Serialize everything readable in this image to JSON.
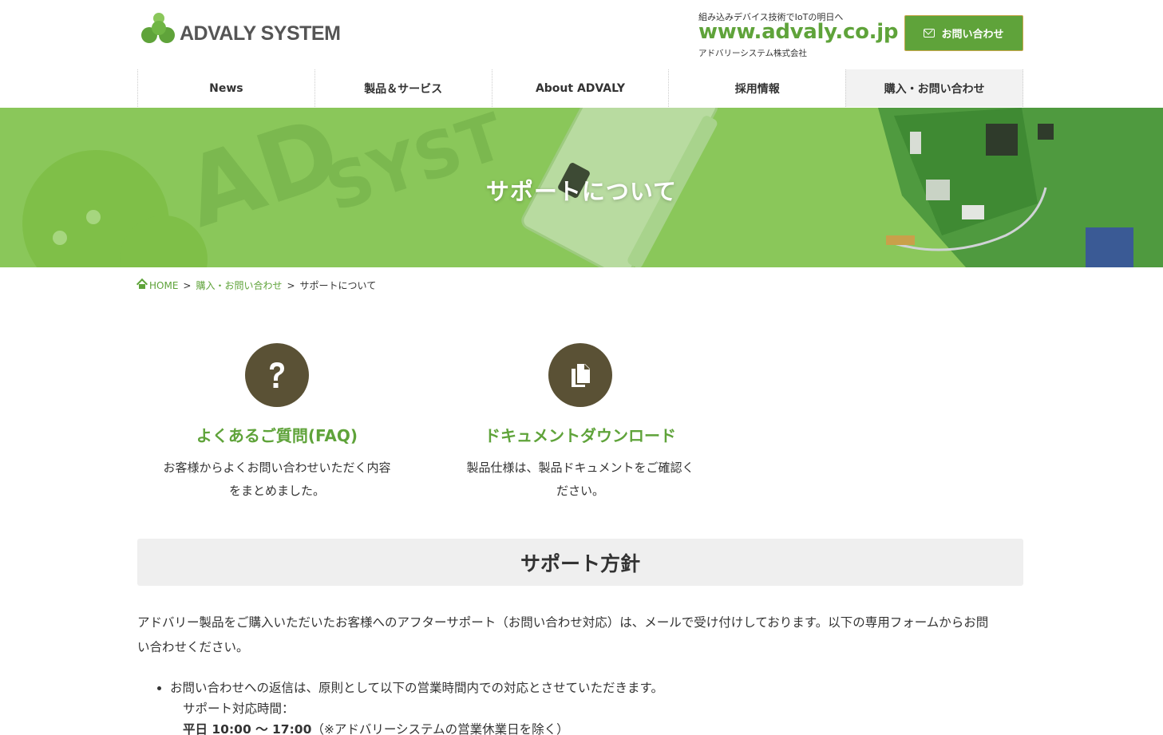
{
  "header": {
    "logo_text": "ADVALY SYSTEM",
    "tagline": "組み込みデバイス技術でIoTの明日へ",
    "url": "www.advaly.co.jp",
    "company": "アドバリーシステム株式会社",
    "contact_button": "お問い合わせ"
  },
  "nav": {
    "items": [
      "News",
      "製品＆サービス",
      "About ADVALY",
      "採用情報",
      "購入・お問い合わせ"
    ]
  },
  "hero": {
    "title": "サポートについて"
  },
  "breadcrumb": {
    "home": "HOME",
    "parent": "購入・お問い合わせ",
    "current": "サポートについて",
    "separator": ">"
  },
  "cards": [
    {
      "icon": "question-icon",
      "title": "よくあるご質問(FAQ)",
      "desc_line1": "お客様からよくお問い合わせいただく内容",
      "desc_line2": "をまとめました。"
    },
    {
      "icon": "documents-icon",
      "title": "ドキュメントダウンロード",
      "desc_line1": "製品仕様は、製品ドキュメントをご確認く",
      "desc_line2": "ださい。"
    }
  ],
  "policy": {
    "heading": "サポート方針",
    "body_line1": "アドバリー製品をご購入いただいたお客様へのアフターサポート（お問い合わせ対応）は、メールで受け付けしております。以下の専用フォームからお問",
    "body_line2": "い合わせください。",
    "bullet1": "お問い合わせへの返信は、原則として以下の営業時間内での対応とさせていただきます。",
    "hours_label": "サポート対応時間：",
    "hours_value": "平日 10:00 〜 17:00",
    "hours_note": "（※アドバリーシステムの営業休業日を除く）"
  },
  "colors": {
    "brand_green": "#5fa33a",
    "hero_green": "#8ac75a",
    "icon_brown": "#5a5135"
  }
}
